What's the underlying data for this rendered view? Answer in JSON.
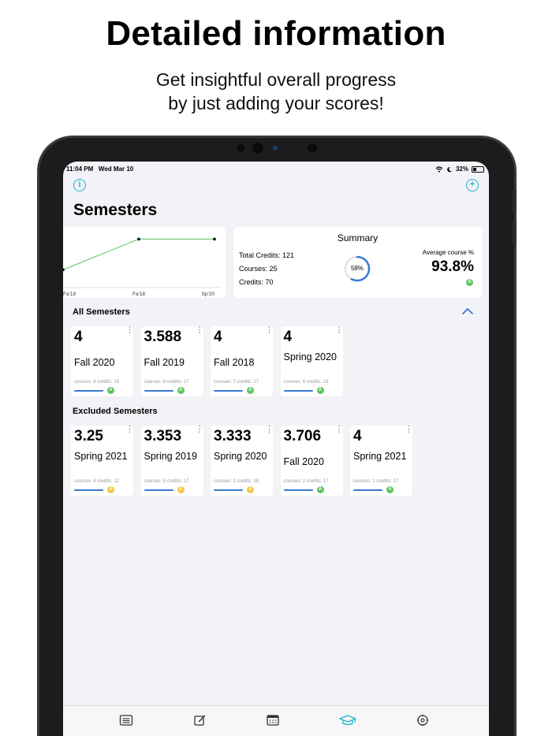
{
  "promo": {
    "title": "Detailed information",
    "subtitle_line1": "Get insightful overall progress",
    "subtitle_line2": "by just adding your scores!"
  },
  "status_bar": {
    "time": "11:04 PM",
    "date": "Wed Mar 10",
    "battery": "32%"
  },
  "header": {
    "info_icon": "info-icon",
    "add_icon": "plus-circle-icon",
    "title": "Semesters"
  },
  "chart_data": {
    "type": "line",
    "categories": [
      "Fa'19",
      "Fa'18",
      "Sp'20"
    ],
    "values": [
      3.588,
      4,
      4
    ],
    "color": "#5cc45f"
  },
  "summary": {
    "title": "Summary",
    "total_credits": "Total Credits: 121",
    "courses": "Courses: 25",
    "credits": "Credits: 70",
    "progress_label": "58%",
    "progress": 0.58,
    "avg_label": "Average course %",
    "avg_value": "93.8%",
    "avg_grade": "A"
  },
  "all_semesters": {
    "title": "All Semesters",
    "toggle_icon": "chevron-up-icon",
    "cards": [
      {
        "gpa": "4",
        "name": "Fall 2020",
        "meta": "courses: 6 credits: 18",
        "grade": "A"
      },
      {
        "gpa": "3.588",
        "name": "Fall 2019",
        "meta": "courses: 6 credits: 17",
        "grade": "A"
      },
      {
        "gpa": "4",
        "name": "Fall 2018",
        "meta": "courses: 7 credits: 17",
        "grade": "A"
      },
      {
        "gpa": "4",
        "name": "Spring 2020",
        "meta": "courses: 6 credits: 18",
        "grade": "A"
      }
    ]
  },
  "excluded_semesters": {
    "title": "Excluded Semesters",
    "cards": [
      {
        "gpa": "3.25",
        "name": "Spring 2021",
        "meta": "courses: 4 credits: 12",
        "grade": "A"
      },
      {
        "gpa": "3.353",
        "name": "Spring 2019",
        "meta": "courses: 5 credits: 17",
        "grade": "A"
      },
      {
        "gpa": "3.333",
        "name": "Spring 2020",
        "meta": "courses: 2 credits: 18",
        "grade": "A"
      },
      {
        "gpa": "3.706",
        "name": "Fall 2020",
        "meta": "courses: 2 credits: 17",
        "grade": "A"
      },
      {
        "gpa": "4",
        "name": "Spring 2021",
        "meta": "courses: 1 credits: 17",
        "grade": "A"
      }
    ]
  },
  "colors": {
    "accent": "#1fb5c8",
    "blue": "#3a7bd5",
    "green": "#5cc45f",
    "yellow": "#f4c542"
  },
  "tab_bar": {
    "tabs": [
      "list-icon",
      "edit-icon",
      "calendar-icon",
      "graduation-cap-icon",
      "settings-icon"
    ],
    "active": "graduation-cap-icon"
  }
}
